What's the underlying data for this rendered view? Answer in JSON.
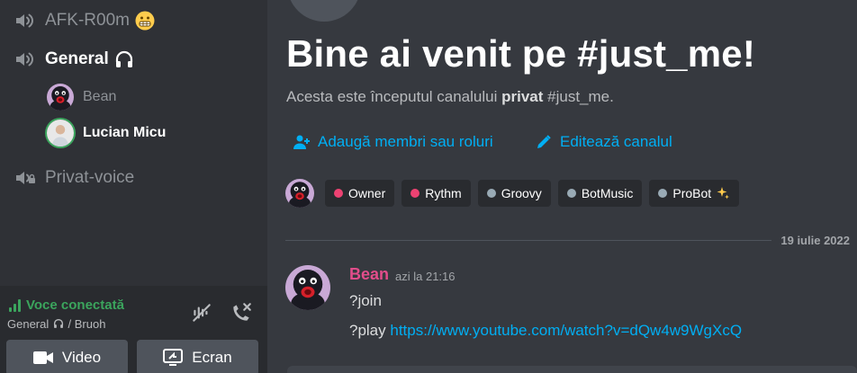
{
  "sidebar": {
    "channels": [
      {
        "name": "AFK-R00m",
        "emoji": "grimacing-face"
      },
      {
        "name": "General",
        "emoji": "headphones"
      },
      {
        "name": "Privat-voice",
        "emoji": ""
      }
    ],
    "members": [
      {
        "name": "Bean",
        "speaking": false
      },
      {
        "name": "Lucian Micu",
        "speaking": true
      }
    ]
  },
  "voice_panel": {
    "status": "Voce conectată",
    "location_channel": "General",
    "location_separator": "/",
    "location_server": "Bruoh",
    "video_label": "Video",
    "screen_label": "Ecran"
  },
  "main": {
    "welcome_title": "Bine ai venit pe #just_me!",
    "intro_prefix": "Acesta este începutul canalului",
    "intro_bold": "privat",
    "intro_suffix": "#just_me.",
    "add_members": "Adaugă membri sau roluri",
    "edit_channel": "Editează canalul",
    "roles": [
      {
        "name": "Owner",
        "color": "#ed4272"
      },
      {
        "name": "Rythm",
        "color": "#ed4272"
      },
      {
        "name": "Groovy",
        "color": "#99aab5"
      },
      {
        "name": "BotMusic",
        "color": "#99aab5"
      },
      {
        "name": "ProBot",
        "color": "#99aab5"
      }
    ],
    "date_separator": "19 iulie 2022",
    "message": {
      "author": "Bean",
      "author_color": "#e24d8b",
      "time": "azi la 21:16",
      "line1": "?join",
      "line2_prefix": "?play",
      "line2_link": "https://www.youtube.com/watch?v=dQw4w9WgXcQ"
    }
  },
  "colors": {
    "sidebar_bg": "#2f3136",
    "main_bg": "#36393f",
    "link": "#00aff4",
    "connected": "#3ba55d"
  }
}
